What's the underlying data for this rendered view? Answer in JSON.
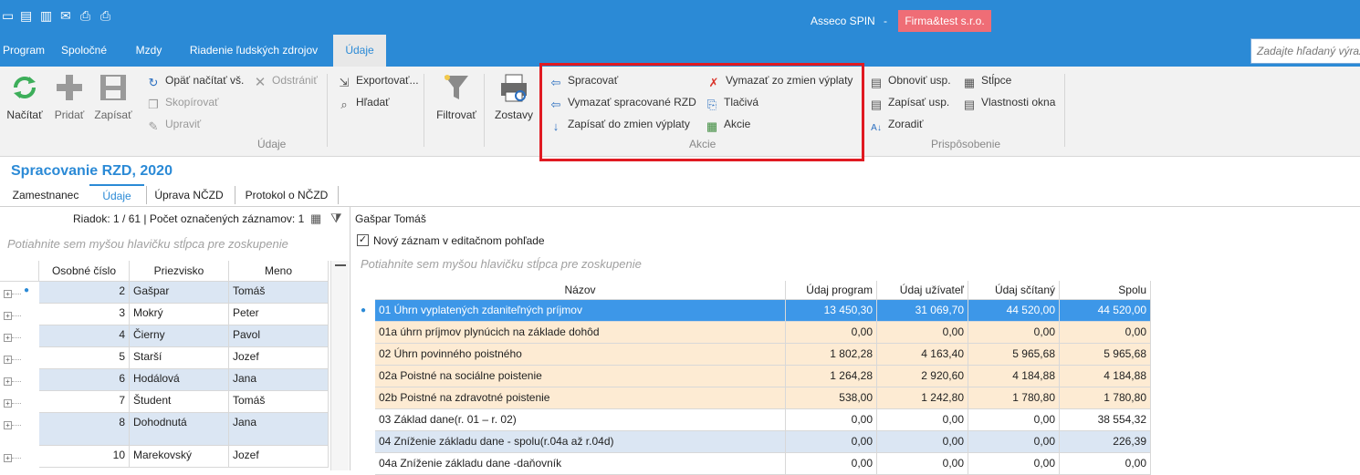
{
  "titlebar": {
    "app_name": "Asseco SPIN",
    "separator": "-",
    "firm": "Firma&test s.r.o.",
    "quick_access_icons": [
      "window-restore-icon",
      "excel-export-icon",
      "pdf-export-icon",
      "email-icon",
      "print-icon",
      "print-preview-icon"
    ]
  },
  "menu": {
    "tabs": [
      "Program",
      "Spoločné",
      "Mzdy",
      "Riadenie ľudských zdrojov",
      "Údaje"
    ],
    "active": "Údaje",
    "search_placeholder": "Zadajte hľadaný výraz"
  },
  "ribbon": {
    "data_group": {
      "label": "Údaje",
      "buttons": {
        "load": "Načítať",
        "add": "Pridať",
        "save": "Zapísať"
      },
      "small": {
        "reload_all": "Opäť načítať vš.",
        "copy": "Skopírovať",
        "edit": "Upraviť",
        "delete": "Odstrániť"
      }
    },
    "export": {
      "export": "Exportovať...",
      "find": "Hľadať"
    },
    "filter": "Filtrovať",
    "reports": "Zostavy",
    "actions_group": {
      "label": "Akcie",
      "process": "Spracovať",
      "delete_processed": "Vymazať spracované RZD",
      "write_to_payroll": "Zapísať do zmien výplaty",
      "delete_from_payroll": "Vymazať zo zmien výplaty",
      "prints": "Tlačivá",
      "actions": "Akcie"
    },
    "customize_group": {
      "label": "Prispôsobenie",
      "restore": "Obnoviť usp.",
      "save": "Zapísať usp.",
      "sort": "Zoradiť",
      "columns": "Stĺpce",
      "window_props": "Vlastnosti okna"
    }
  },
  "page": {
    "title": "Spracovanie RZD, 2020",
    "subtabs": [
      "Zamestnanec",
      "Údaje",
      "Úprava NČZD",
      "Protokol o NČZD"
    ],
    "active_subtab": "Údaje"
  },
  "left_grid": {
    "row_info": "Riadok: 1 / 61 | Počet označených záznamov: 1",
    "group_hint": "Potiahnite sem myšou hlavičku stĺpca pre zoskupenie",
    "columns": [
      "Osobné číslo",
      "Priezvisko",
      "Meno"
    ],
    "rows": [
      {
        "id": "2",
        "surname": "Gašpar",
        "name": "Tomáš"
      },
      {
        "id": "3",
        "surname": "Mokrý",
        "name": "Peter"
      },
      {
        "id": "4",
        "surname": "Čierny",
        "name": "Pavol"
      },
      {
        "id": "5",
        "surname": "Starší",
        "name": "Jozef"
      },
      {
        "id": "6",
        "surname": "Hodálová",
        "name": "Jana"
      },
      {
        "id": "7",
        "surname": "Študent",
        "name": "Tomáš"
      },
      {
        "id": "8",
        "surname": "Dohodnutá",
        "name": "Jana"
      },
      {
        "id": "10",
        "surname": "Marekovský",
        "name": "Jozef"
      }
    ]
  },
  "right_grid": {
    "person": "Gašpar Tomáš",
    "new_record_label": "Nový záznam v editačnom pohľade",
    "new_record_checked": "✓",
    "group_hint": "Potiahnite sem myšou hlavičku stĺpca pre zoskupenie",
    "columns": [
      "Názov",
      "Údaj program",
      "Údaj užívateľ",
      "Údaj sčítaný",
      "Spolu"
    ],
    "rows": [
      {
        "name": "01 Úhrn vyplatených zdaniteľných príjmov",
        "prog": "13 450,30",
        "user": "31 069,70",
        "sum": "44 520,00",
        "total": "44 520,00"
      },
      {
        "name": "01a úhrn príjmov plynúcich na základe dohôd",
        "prog": "0,00",
        "user": "0,00",
        "sum": "0,00",
        "total": "0,00"
      },
      {
        "name": "02 Úhrn povinného poistného",
        "prog": "1 802,28",
        "user": "4 163,40",
        "sum": "5 965,68",
        "total": "5 965,68"
      },
      {
        "name": "02a Poistné na sociálne poistenie",
        "prog": "1 264,28",
        "user": "2 920,60",
        "sum": "4 184,88",
        "total": "4 184,88"
      },
      {
        "name": "02b Poistné na zdravotné poistenie",
        "prog": "538,00",
        "user": "1 242,80",
        "sum": "1 780,80",
        "total": "1 780,80"
      },
      {
        "name": "03 Základ dane(r. 01 – r. 02)",
        "prog": "0,00",
        "user": "0,00",
        "sum": "0,00",
        "total": "38 554,32"
      },
      {
        "name": "04 Zníženie základu dane - spolu(r.04a až r.04d)",
        "prog": "0,00",
        "user": "0,00",
        "sum": "0,00",
        "total": "226,39"
      },
      {
        "name": "04a Zníženie základu dane -daňovník",
        "prog": "0,00",
        "user": "0,00",
        "sum": "0,00",
        "total": "0,00"
      }
    ]
  },
  "colors": {
    "accent": "#2b8ad6",
    "firm_badge": "#ef6d76",
    "highlight": "#e01a22",
    "row_peach": "#fdebd3",
    "row_blue": "#dbe6f3",
    "row_selected": "#3d97e8"
  }
}
